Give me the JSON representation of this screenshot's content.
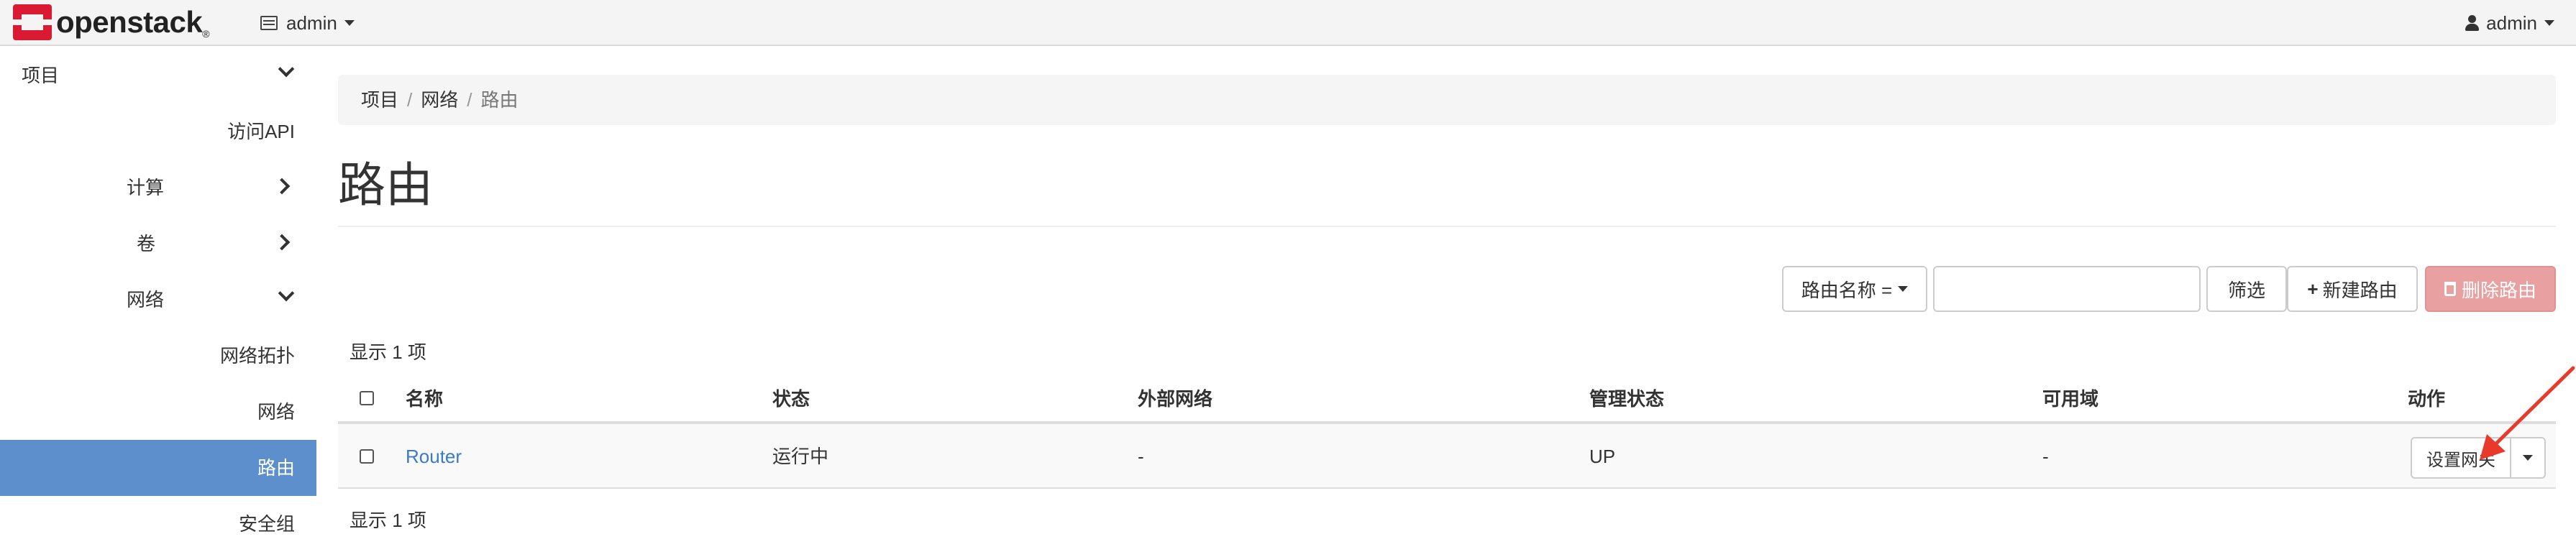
{
  "navbar": {
    "brand": "openstack",
    "brand_reg": "®",
    "project": "admin",
    "user": "admin"
  },
  "sidebar": {
    "items": [
      {
        "label": "项目",
        "level": 0,
        "chevron": "down"
      },
      {
        "label": "访问API",
        "level": 1
      },
      {
        "label": "计算",
        "level": 1,
        "chevron": "right"
      },
      {
        "label": "卷",
        "level": 1,
        "chevron": "right"
      },
      {
        "label": "网络",
        "level": 1,
        "chevron": "down"
      },
      {
        "label": "网络拓扑",
        "level": 2
      },
      {
        "label": "网络",
        "level": 2
      },
      {
        "label": "路由",
        "level": 2,
        "active": true
      },
      {
        "label": "安全组",
        "level": 2
      }
    ]
  },
  "breadcrumb": [
    "项目",
    "网络",
    "路由"
  ],
  "page_title": "路由",
  "toolbar": {
    "filter_select": "路由名称 =",
    "filter_value": "",
    "filter_button": "筛选",
    "create_button": "新建路由",
    "delete_button": "删除路由"
  },
  "count_top": "显示 1 项",
  "count_bottom": "显示 1 项",
  "table": {
    "headers": [
      "名称",
      "状态",
      "外部网络",
      "管理状态",
      "可用域",
      "动作"
    ],
    "rows": [
      {
        "name": "Router",
        "status": "运行中",
        "external_network": "-",
        "admin_state": "UP",
        "availability_zone": "-",
        "action": "设置网关"
      }
    ]
  },
  "colors": {
    "accent": "#5c8fcc",
    "link": "#3a7bc8",
    "danger": "#e8a0a0",
    "brand_red": "#da1a32",
    "annotation_arrow": "#e8392a"
  },
  "icons": [
    "openstack-logo-icon",
    "project-icon",
    "user-icon",
    "chevron-down-icon",
    "chevron-right-icon",
    "plus-icon",
    "trash-icon",
    "caret-down-icon"
  ]
}
